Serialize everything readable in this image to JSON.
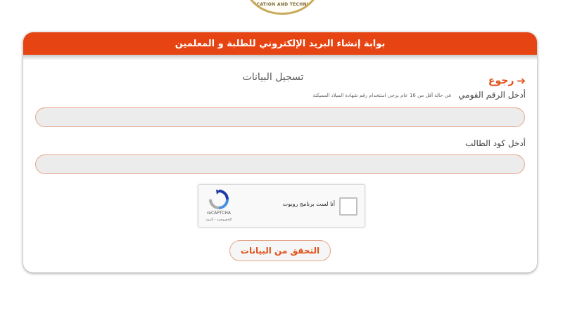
{
  "logo": {
    "text": "EDUCATION AND TECHNICAL"
  },
  "banner": {
    "title": "بوابة إنشاء البريد الإلكتروني للطلبة و المعلمين"
  },
  "form": {
    "title": "تسجيل البيانات",
    "back_label": "رجوع",
    "national_id_label": "أدخل الرقم القومي",
    "national_id_hint": "في حالة أقل من 16 عام يرجى استخدام رقم شهادة الميلاد المميكنة",
    "national_id_value": "",
    "student_code_label": "أدخل كود الطالب",
    "student_code_value": "",
    "submit_label": "التحقق من البيانات"
  },
  "recaptcha": {
    "checkbox_label": "أنا لست برنامج روبوت",
    "brand": "reCAPTCHA",
    "links": "الخصوصية - البنود"
  },
  "colors": {
    "accent": "#e64412",
    "link": "#e0531d",
    "field_bg": "#ececec",
    "field_border": "#e8a488"
  }
}
